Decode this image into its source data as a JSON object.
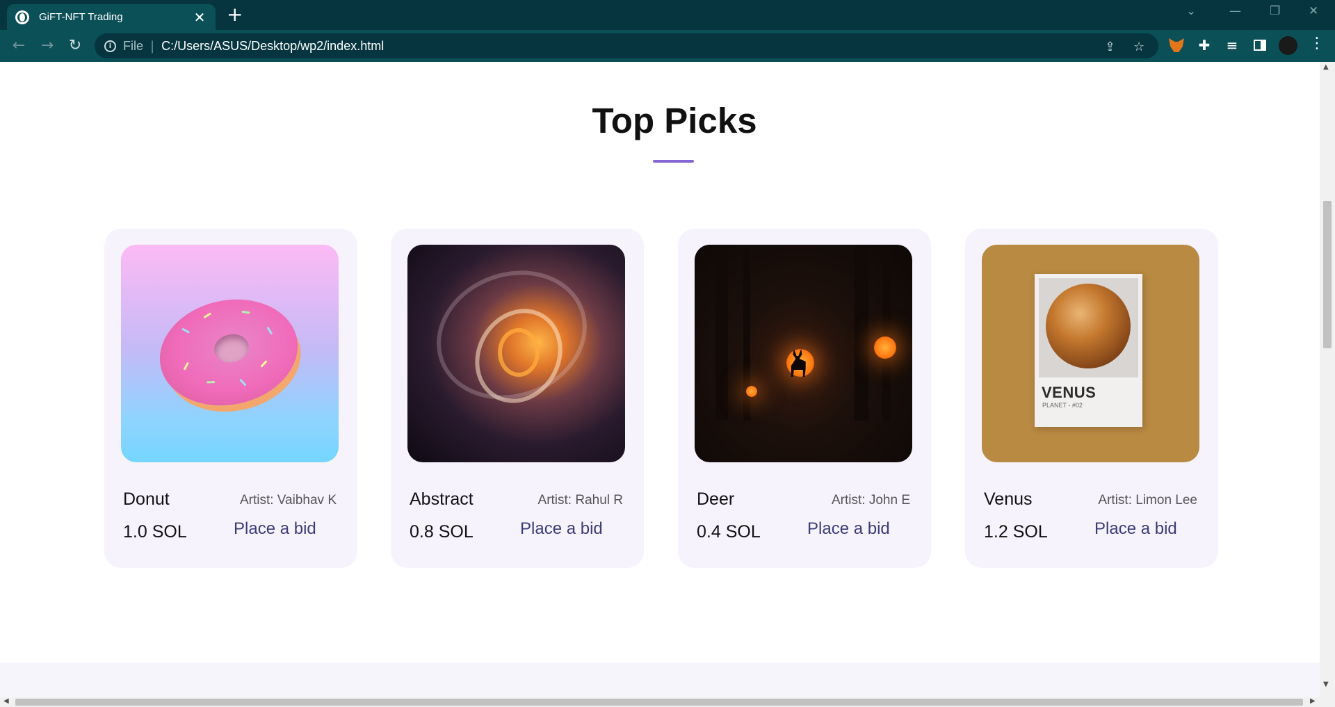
{
  "browser": {
    "tab_title": "GiFT-NFT Trading",
    "tab_close": "✕",
    "new_tab": "+",
    "scheme": "File",
    "url": "C:/Users/ASUS/Desktop/wp2/index.html",
    "window_controls": {
      "dropdown": "⌄",
      "minimize": "—",
      "restore": "❐",
      "close": "✕"
    }
  },
  "section": {
    "title": "Top Picks",
    "accent_color": "#8667d4",
    "card_bg": "#f6f3fd",
    "bid_color": "#3d3c7a"
  },
  "cards": [
    {
      "name": "Donut",
      "artist": "Artist: Vaibhav K",
      "price": "1.0 SOL",
      "bid": "Place a bid"
    },
    {
      "name": "Abstract",
      "artist": "Artist: Rahul R",
      "price": "0.8 SOL",
      "bid": "Place a bid"
    },
    {
      "name": "Deer",
      "artist": "Artist: John E",
      "price": "0.4 SOL",
      "bid": "Place a bid"
    },
    {
      "name": "Venus",
      "artist": "Artist: Limon Lee",
      "price": "1.2 SOL",
      "bid": "Place a bid",
      "image_text": "VENUS",
      "image_subtext": "PLANET - #02"
    }
  ]
}
